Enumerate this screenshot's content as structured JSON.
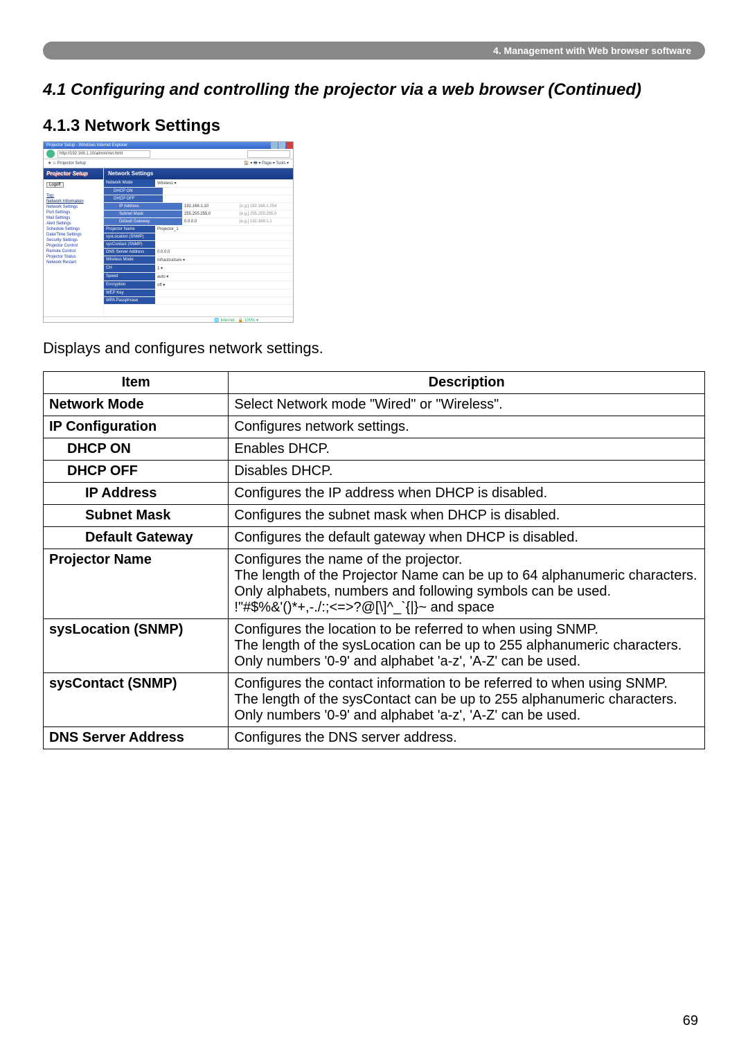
{
  "header_tab": "4. Management with Web browser software",
  "h1": "4.1 Configuring and controlling the projector via a web browser (Continued)",
  "h2": "4.1.3 Network Settings",
  "intro": "Displays and configures network settings.",
  "page_number": "69",
  "screenshot": {
    "window_title": "Projector Setup - Windows Internet Explorer",
    "address": "http://192.168.1.10/admin/net.html",
    "fav_label": "Projector Setup",
    "sidebar_logo": "Projector Setup",
    "logoff": "Logoff",
    "side_items": [
      "Top:",
      "Network Information",
      "Network Settings",
      "Port Settings",
      "Mail Settings",
      "Alert Settings",
      "Schedule Settings",
      "Date/Time Settings",
      "Security Settings",
      "Projector Control",
      "Remote Control",
      "Projector Status",
      "Network Restart"
    ],
    "panel_title": "Network Settings",
    "rows": [
      {
        "lab": "Network Mode",
        "val": "Wireless ▾"
      },
      {
        "lab": "DHCP ON",
        "sub": true,
        "val": ""
      },
      {
        "lab": "DHCP OFF",
        "sub": true,
        "val": ""
      },
      {
        "lab": "IP Address",
        "sub2": true,
        "v1": "192.168.1.10",
        "v2": "[e.g.] 192.168.1.254"
      },
      {
        "lab": "Subnet Mask",
        "sub2": true,
        "v1": "255.255.255.0",
        "v2": "[e.g.] 255.255.255.0"
      },
      {
        "lab": "Default Gateway",
        "sub2": true,
        "v1": "0.0.0.0",
        "v2": "[e.g.] 192.168.1.1"
      },
      {
        "lab": "Projector Name",
        "val": "Projector_1"
      },
      {
        "lab": "sysLocation (SNMP)",
        "val": ""
      },
      {
        "lab": "sysContact (SNMP)",
        "val": ""
      },
      {
        "lab": "DNS Server Address",
        "val": "0.0.0.0"
      },
      {
        "lab": "Wireless Mode",
        "val": "Infrastructure ▾"
      },
      {
        "lab": "CH",
        "val": "1 ▾"
      },
      {
        "lab": "Speed",
        "val": "auto ▾"
      },
      {
        "lab": "Encryption",
        "val": "off ▾"
      },
      {
        "lab": "WEP Key",
        "val": ""
      },
      {
        "lab": "WPA Passphrase",
        "val": ""
      }
    ],
    "ip_config_lab": "IP Configuration",
    "footer": "Internet"
  },
  "table": {
    "headers": [
      "Item",
      "Description"
    ],
    "rows": [
      {
        "item": "Network Mode",
        "indent": 0,
        "desc": "Select Network mode \"Wired\" or \"Wireless\"."
      },
      {
        "item": "IP Configuration",
        "indent": 0,
        "desc": "Configures network settings."
      },
      {
        "item": "DHCP ON",
        "indent": 1,
        "desc": "Enables DHCP."
      },
      {
        "item": "DHCP OFF",
        "indent": 1,
        "desc": "Disables DHCP."
      },
      {
        "item": "IP Address",
        "indent": 2,
        "desc": "Configures the IP address when DHCP is disabled."
      },
      {
        "item": "Subnet Mask",
        "indent": 2,
        "desc": "Configures the subnet mask when DHCP is disabled."
      },
      {
        "item": "Default Gateway",
        "indent": 2,
        "desc": "Configures the default gateway when DHCP is disabled."
      },
      {
        "item": "Projector Name",
        "indent": 0,
        "desc": "Configures the name of the projector.\nThe length of the Projector Name can be up to 64 alphanumeric characters. Only alphabets, numbers and following symbols can be used.  !\"#$%&'()*+,-./:;<=>?@[\\]^_`{|}~ and space"
      },
      {
        "item": "sysLocation (SNMP)",
        "indent": 0,
        "desc": "Configures the location to be referred to when using SNMP.\nThe length of the sysLocation can be up to 255 alphanumeric characters.  Only numbers '0-9' and alphabet 'a-z', 'A-Z' can be used."
      },
      {
        "item": "sysContact (SNMP)",
        "indent": 0,
        "desc": "Configures the contact information to be referred to when using SNMP.\nThe length of the sysContact can be up to 255 alphanumeric characters.  Only numbers '0-9' and alphabet 'a-z', 'A-Z' can be used."
      },
      {
        "item": "DNS Server Address",
        "indent": 0,
        "desc": "Configures the DNS  server address."
      }
    ]
  }
}
